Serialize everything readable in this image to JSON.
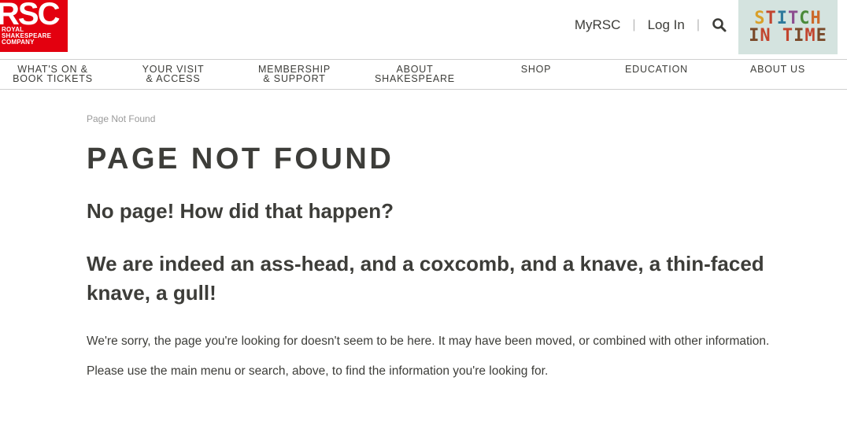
{
  "logo": {
    "mark": "RSC",
    "lines": [
      "ROYAL",
      "SHAKESPEARE",
      "COMPANY"
    ],
    "color": "#e3000f"
  },
  "utility": {
    "myrsc": "MyRSC",
    "login": "Log In",
    "search_icon": "search-icon"
  },
  "promo": {
    "line1": [
      "S",
      "T",
      "I",
      "T",
      "C",
      "H"
    ],
    "line2": [
      "I",
      "N",
      " ",
      "T",
      "I",
      "M",
      "E"
    ]
  },
  "nav": {
    "items": [
      {
        "line1": "WHAT'S ON &",
        "line2": "BOOK TICKETS"
      },
      {
        "line1": "YOUR VISIT",
        "line2": "& ACCESS"
      },
      {
        "line1": "MEMBERSHIP",
        "line2": "& SUPPORT"
      },
      {
        "line1": "ABOUT",
        "line2": "SHAKESPEARE"
      },
      {
        "line1": "SHOP",
        "line2": ""
      },
      {
        "line1": "EDUCATION",
        "line2": ""
      },
      {
        "line1": "ABOUT US",
        "line2": ""
      }
    ]
  },
  "main": {
    "breadcrumb": "Page Not Found",
    "title": "PAGE NOT FOUND",
    "subtitle1": "No page! How did that happen?",
    "subtitle2": "We are indeed an ass-head, and a coxcomb, and a knave, a thin-faced knave, a gull!",
    "body1": "We're sorry, the page you're looking for doesn't seem to be here. It may have been moved, or combined with other information.",
    "body2": "Please use the main menu or search, above, to find the information you're looking for."
  }
}
